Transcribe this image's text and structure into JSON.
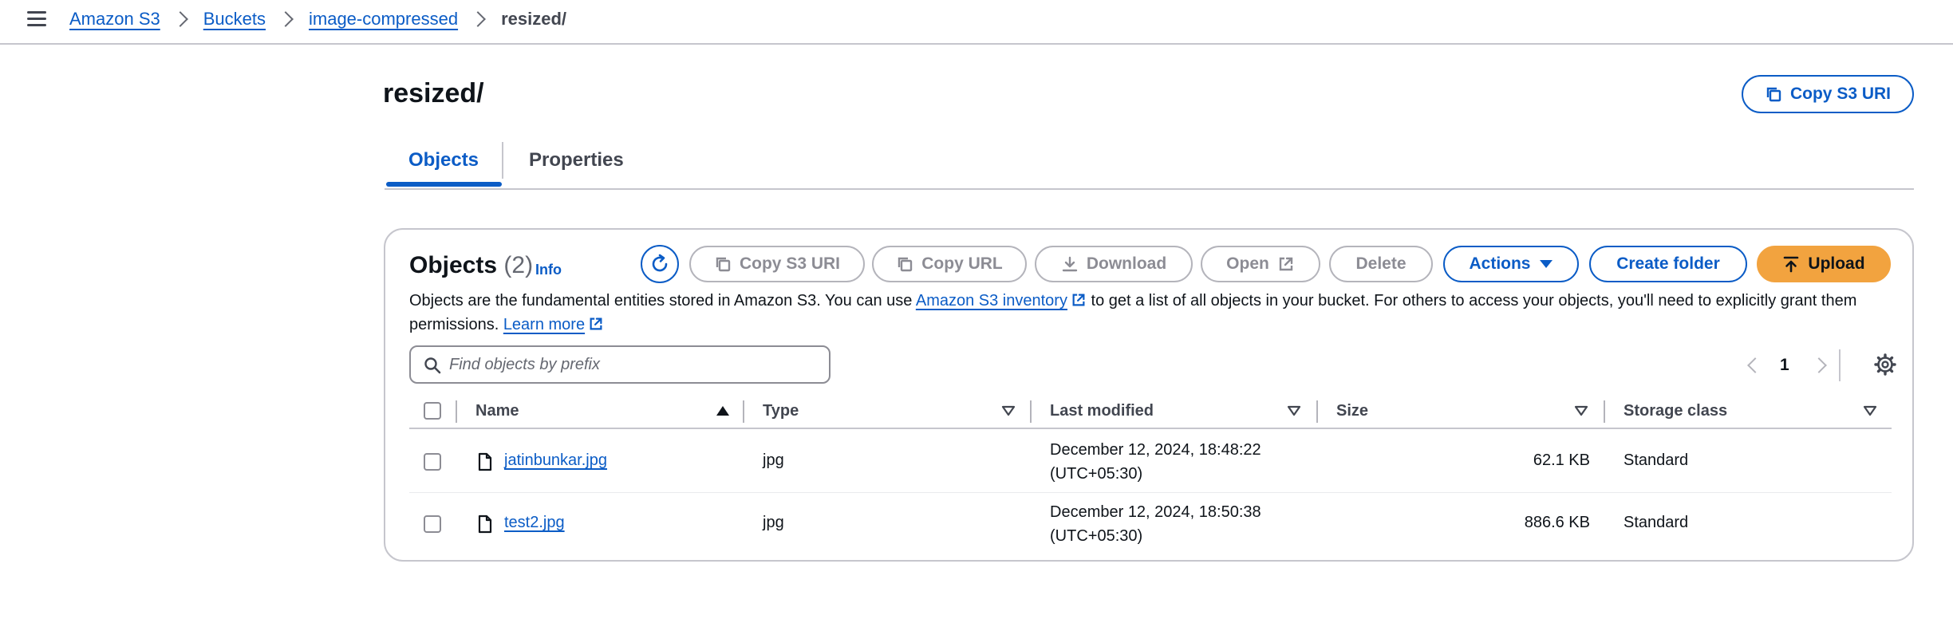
{
  "breadcrumb": {
    "items": [
      "Amazon S3",
      "Buckets",
      "image-compressed"
    ],
    "current": "resized/"
  },
  "page": {
    "title": "resized/",
    "copy_uri_label": "Copy S3 URI"
  },
  "tabs": [
    {
      "label": "Objects",
      "active": true
    },
    {
      "label": "Properties",
      "active": false
    }
  ],
  "objects_panel": {
    "title": "Objects",
    "count": "(2)",
    "info": "Info",
    "buttons": {
      "copy_s3_uri": "Copy S3 URI",
      "copy_url": "Copy URL",
      "download": "Download",
      "open": "Open",
      "delete": "Delete",
      "actions": "Actions",
      "create_folder": "Create folder",
      "upload": "Upload"
    },
    "description": {
      "part1": "Objects are the fundamental entities stored in Amazon S3. You can use ",
      "link1": "Amazon S3 inventory",
      "part2": " to get a list of all objects in your bucket. For others to access your objects, you'll need to explicitly grant them permissions. ",
      "link2": "Learn more"
    },
    "search": {
      "placeholder": "Find objects by prefix",
      "value": ""
    },
    "pagination": {
      "current_page": "1"
    },
    "table": {
      "columns": [
        "Name",
        "Type",
        "Last modified",
        "Size",
        "Storage class"
      ],
      "rows": [
        {
          "name": "jatinbunkar.jpg",
          "type": "jpg",
          "modified_line1": "December 12, 2024, 18:48:22",
          "modified_line2": "(UTC+05:30)",
          "size": "62.1 KB",
          "storage_class": "Standard"
        },
        {
          "name": "test2.jpg",
          "type": "jpg",
          "modified_line1": "December 12, 2024, 18:50:38",
          "modified_line2": "(UTC+05:30)",
          "size": "886.6 KB",
          "storage_class": "Standard"
        }
      ]
    }
  },
  "colors": {
    "link": "#0b5cc6",
    "upload": "#f2a33f",
    "border": "#c6c6cd",
    "disabled": "#8c8c94"
  },
  "icons": [
    "menu-icon",
    "chevron-right-icon",
    "copy-icon",
    "refresh-icon",
    "download-icon",
    "external-link-icon",
    "caret-down-icon",
    "upload-icon",
    "search-icon",
    "chevron-left-icon",
    "gear-icon",
    "sort-ascending-icon",
    "sort-icon",
    "file-icon"
  ]
}
